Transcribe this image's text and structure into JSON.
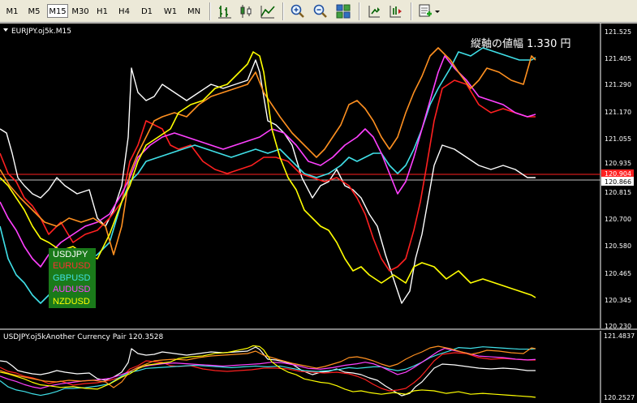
{
  "toolbar": {
    "timeframes": [
      "M1",
      "M5",
      "M15",
      "M30",
      "H1",
      "H4",
      "D1",
      "W1",
      "MN"
    ],
    "active_timeframe": "M15",
    "tool_icons": [
      "bar-chart-icon",
      "candlestick-chart-icon",
      "line-chart-icon",
      "zoom-in-icon",
      "zoom-out-icon",
      "tile-windows-icon",
      "auto-scroll-icon",
      "chart-shift-icon",
      "indicators-icon"
    ]
  },
  "main_chart": {
    "title": "EURJPY.oj5k.M15",
    "range_text": "縦軸の値幅 1.330 円",
    "price_labels": [
      "121.525",
      "121.405",
      "121.290",
      "121.170",
      "121.055",
      "120.935",
      "120.815",
      "120.700",
      "120.580",
      "120.465",
      "120.345",
      "120.230"
    ],
    "current_price_red": "120.904",
    "current_price_white": "120.866",
    "legend": [
      {
        "label": "USDJPY",
        "color": "#ffffff"
      },
      {
        "label": "EURUSD",
        "color": "#ff3030"
      },
      {
        "label": "GBPUSD",
        "color": "#40e0e0"
      },
      {
        "label": "AUDUSD",
        "color": "#ff40ff"
      },
      {
        "label": "NZDUSD",
        "color": "#ffff00"
      }
    ],
    "legend_bg": "#1a7a1a"
  },
  "sub_chart": {
    "title": "USDJPY.oj5kAnother Currency Pair 120.3528",
    "price_high": "121.4837",
    "price_low": "120.2527"
  },
  "colors": {
    "usdjpy": "#ffffff",
    "eurusd": "#ff2020",
    "gbpusd": "#40e0e8",
    "audusd": "#ff40ff",
    "nzdusd": "#ffff00",
    "eurjpy": "#ff9020"
  }
}
